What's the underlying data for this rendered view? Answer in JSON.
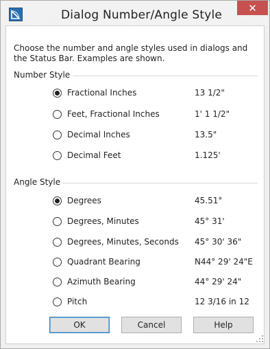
{
  "window": {
    "title": "Dialog Number/Angle Style",
    "close_glyph": "✕",
    "app_icon": "app-icon"
  },
  "intro_text": "Choose the number and angle styles used in dialogs and the Status Bar.  Examples are shown.",
  "number_style": {
    "label": "Number Style",
    "options": [
      {
        "label": "Fractional Inches",
        "example": "13 1/2\"",
        "checked": true
      },
      {
        "label": "Feet, Fractional Inches",
        "example": "1' 1 1/2\"",
        "checked": false
      },
      {
        "label": "Decimal Inches",
        "example": "13.5\"",
        "checked": false
      },
      {
        "label": "Decimal Feet",
        "example": "1.125'",
        "checked": false
      }
    ]
  },
  "angle_style": {
    "label": "Angle Style",
    "options": [
      {
        "label": "Degrees",
        "example": "45.51°",
        "checked": true
      },
      {
        "label": "Degrees, Minutes",
        "example": "45° 31'",
        "checked": false
      },
      {
        "label": "Degrees, Minutes, Seconds",
        "example": "45° 30' 36\"",
        "checked": false
      },
      {
        "label": "Quadrant Bearing",
        "example": "N44° 29' 24\"E",
        "checked": false
      },
      {
        "label": "Azimuth Bearing",
        "example": "44° 29' 24\"",
        "checked": false
      },
      {
        "label": "Pitch",
        "example": "12 3/16 in 12",
        "checked": false
      }
    ]
  },
  "buttons": {
    "ok": "OK",
    "cancel": "Cancel",
    "help": "Help"
  }
}
